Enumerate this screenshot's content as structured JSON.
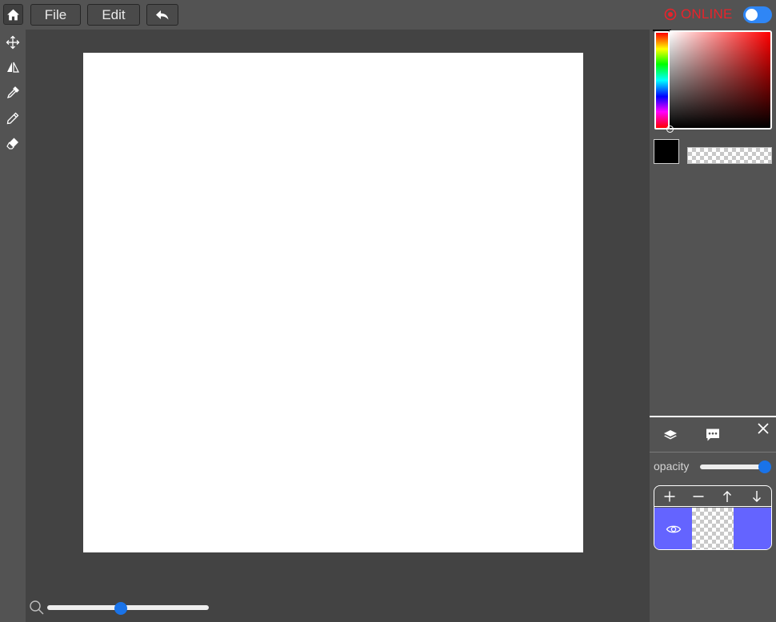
{
  "topbar": {
    "home_icon": "home-icon",
    "file_label": "File",
    "edit_label": "Edit",
    "undo_icon": "undo-icon",
    "status_icon": "record-icon",
    "status_label": "ONLINE",
    "status_color": "#e8232b",
    "toggle_on": true,
    "toggle_color": "#2f86f5"
  },
  "tools": [
    {
      "name": "move-tool",
      "icon": "move-icon"
    },
    {
      "name": "flip-tool",
      "icon": "flip-icon"
    },
    {
      "name": "eyedropper-tool",
      "icon": "eyedropper-icon"
    },
    {
      "name": "pencil-tool",
      "icon": "pencil-icon"
    },
    {
      "name": "eraser-tool",
      "icon": "eraser-icon"
    }
  ],
  "canvas": {
    "background": "#ffffff",
    "zoom_level": 0.45
  },
  "color_picker": {
    "current_color": "#000000",
    "hue": "#ff0000"
  },
  "panel": {
    "tabs": [
      {
        "name": "tab-layers",
        "icon": "layers-icon"
      },
      {
        "name": "tab-chat",
        "icon": "chat-icon"
      }
    ],
    "close_icon": "close-icon",
    "opacity_label": "opacity",
    "opacity_value": 1.0,
    "layer_buttons": [
      "add-layer",
      "remove-layer",
      "move-layer-up",
      "move-layer-down"
    ],
    "layers": [
      {
        "visible": true,
        "selected": true,
        "color": "#6464ff"
      }
    ]
  }
}
